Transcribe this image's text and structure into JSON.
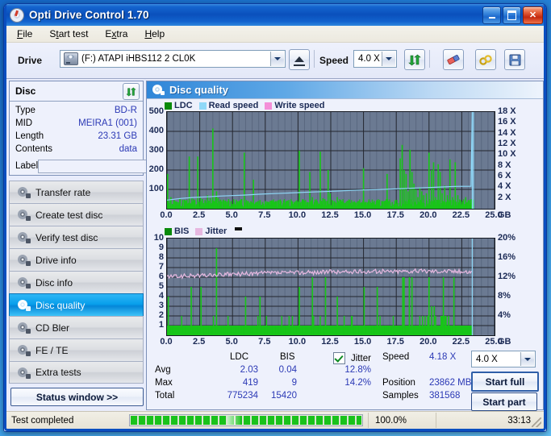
{
  "window": {
    "title": "Opti Drive Control 1.70",
    "icon": "disc-icon",
    "buttons": {
      "minimize": "–",
      "maximize": "□",
      "close": "✕"
    }
  },
  "menu": {
    "items": [
      "File",
      "Start test",
      "Extra",
      "Help"
    ]
  },
  "toolbar": {
    "drive_label": "Drive",
    "drive_value": "(F:)  ATAPI iHBS112  2 CL0K",
    "eject_icon": "eject-icon",
    "speed_label": "Speed",
    "speed_value": "4.0 X",
    "refresh_icon": "refresh-icon",
    "eraser_icon": "eraser-icon",
    "tools_icon": "tools-icon",
    "save_icon": "save-icon"
  },
  "sidebar": {
    "disc_title": "Disc",
    "disc_refresh_icon": "refresh-icon",
    "fields": [
      {
        "key": "Type",
        "value": "BD-R"
      },
      {
        "key": "MID",
        "value": "MEIRA1 (001)"
      },
      {
        "key": "Length",
        "value": "23.31 GB"
      },
      {
        "key": "Contents",
        "value": "data"
      }
    ],
    "label_key": "Label",
    "label_value": "",
    "label_placeholder": "",
    "disc_button_icon": "cd-disc-icon",
    "nav": [
      {
        "label": "Transfer rate",
        "active": false
      },
      {
        "label": "Create test disc",
        "active": false
      },
      {
        "label": "Verify test disc",
        "active": false
      },
      {
        "label": "Drive info",
        "active": false
      },
      {
        "label": "Disc info",
        "active": false
      },
      {
        "label": "Disc quality",
        "active": true
      },
      {
        "label": "CD Bler",
        "active": false
      },
      {
        "label": "FE / TE",
        "active": false
      },
      {
        "label": "Extra tests",
        "active": false
      }
    ],
    "status_window_button": "Status window >>"
  },
  "main": {
    "header_title": "Disc quality",
    "header_icon": "disc-quality-icon",
    "stats": {
      "col_headers": [
        "LDC",
        "BIS"
      ],
      "rows": [
        {
          "label": "Avg",
          "ldc": "2.03",
          "bis": "0.04",
          "jitter": "12.8%"
        },
        {
          "label": "Max",
          "ldc": "419",
          "bis": "9",
          "jitter": "14.2%"
        },
        {
          "label": "Total",
          "ldc": "775234",
          "bis": "15420",
          "jitter": ""
        }
      ],
      "jitter_label": "Jitter",
      "jitter_checked": true,
      "right": [
        {
          "key": "Speed",
          "value": "4.18 X"
        },
        {
          "key": "Position",
          "value": "23862 MB"
        },
        {
          "key": "Samples",
          "value": "381568"
        }
      ],
      "speed_select": "4.0 X",
      "start_full_button": "Start full",
      "start_part_button": "Start part"
    }
  },
  "statusbar": {
    "message": "Test completed",
    "progress_text": "100.0%",
    "progress_value": 100,
    "elapsed": "33:13"
  },
  "colors": {
    "ldc_green": "#18c518",
    "read_speed_blue": "#8fd8f8",
    "write_speed_pink": "#f48fd8",
    "bis_green": "#18c518",
    "jitter_pink": "#e6b8e0",
    "plot_bg": "#6b7a92",
    "accent_blue": "#2b39b5",
    "active_nav": "#08a0ec"
  },
  "chart_data": [
    {
      "type": "line",
      "title": "LDC / Read speed / Write speed",
      "xlabel": "GB",
      "ylabel": "LDC",
      "y2label": "Speed (X)",
      "xlim": [
        0.0,
        25.0
      ],
      "ylim": [
        0,
        500
      ],
      "y2lim": [
        0,
        18
      ],
      "xticks": [
        "0.0",
        "2.5",
        "5.0",
        "7.5",
        "10.0",
        "12.5",
        "15.0",
        "17.5",
        "20.0",
        "22.5",
        "25.0"
      ],
      "yticks": [
        100,
        200,
        300,
        400,
        500
      ],
      "y2ticks": [
        "2 X",
        "4 X",
        "6 X",
        "8 X",
        "10 X",
        "12 X",
        "14 X",
        "16 X",
        "18 X"
      ],
      "xunit": "GB",
      "grid": true,
      "legend": [
        {
          "name": "LDC",
          "color": "#0a8a0a"
        },
        {
          "name": "Read speed",
          "color": "#8fd8f8"
        },
        {
          "name": "Write speed",
          "color": "#f48fd8"
        }
      ],
      "series": [
        {
          "name": "LDC",
          "type": "impulse",
          "color": "#18c518",
          "x": [
            0.05,
            0.3,
            0.55,
            0.8,
            1.0,
            1.2,
            1.45,
            1.7,
            1.9,
            2.1,
            2.35,
            2.55,
            2.7,
            2.9,
            3.1,
            3.3,
            3.5,
            3.7,
            3.78,
            3.9,
            4.1,
            4.3,
            4.5,
            4.7,
            4.9,
            5.1,
            5.3,
            5.5,
            5.7,
            5.9,
            6.05,
            6.2,
            6.4,
            6.6,
            6.8,
            6.95,
            7.1,
            7.3,
            7.5,
            7.7,
            7.9,
            8.1,
            8.3,
            8.5,
            8.7,
            8.9,
            9.1,
            9.3,
            9.5,
            9.7,
            9.9,
            10.1,
            10.35,
            10.5,
            10.7,
            10.9,
            11.1,
            11.3,
            11.5,
            11.7,
            11.9,
            12.1,
            12.3,
            12.45,
            12.6,
            12.8,
            13.0,
            13.2,
            13.4,
            13.6,
            13.8,
            14.0,
            14.2,
            14.4,
            14.6,
            14.8,
            15.0,
            15.2,
            15.4,
            15.6,
            15.8,
            16.0,
            16.2,
            16.4,
            16.6,
            16.8,
            17.0,
            17.2,
            17.4,
            17.6,
            17.8,
            17.95,
            18.1,
            18.25,
            18.4,
            18.55,
            18.7,
            18.85,
            19.0,
            19.15,
            19.3,
            19.45,
            19.6,
            19.8,
            20.0,
            20.2,
            20.35,
            20.5,
            20.7,
            20.85,
            21.0,
            21.2,
            21.4,
            21.6,
            21.8,
            22.0,
            22.2,
            22.4,
            22.6,
            22.8,
            23.0,
            23.2,
            23.4
          ],
          "y": [
            180,
            60,
            40,
            35,
            50,
            45,
            40,
            270,
            55,
            45,
            270,
            60,
            50,
            45,
            70,
            55,
            415,
            60,
            90,
            55,
            45,
            40,
            35,
            50,
            40,
            45,
            35,
            40,
            50,
            290,
            45,
            40,
            40,
            150,
            35,
            40,
            45,
            35,
            40,
            35,
            40,
            35,
            40,
            35,
            40,
            35,
            40,
            35,
            40,
            35,
            40,
            300,
            45,
            40,
            35,
            190,
            60,
            40,
            35,
            295,
            55,
            40,
            200,
            80,
            45,
            40,
            60,
            35,
            40,
            30,
            40,
            30,
            35,
            30,
            40,
            30,
            210,
            35,
            40,
            30,
            35,
            40,
            30,
            40,
            30,
            180,
            40,
            35,
            40,
            30,
            260,
            330,
            200,
            180,
            90,
            305,
            190,
            130,
            100,
            60,
            110,
            90,
            70,
            80,
            290,
            200,
            240,
            60,
            230,
            190,
            80,
            120,
            70,
            255,
            60,
            240,
            70,
            45,
            40,
            60,
            40,
            30,
            35
          ]
        },
        {
          "name": "Read speed",
          "type": "line",
          "color": "#8fd8f8",
          "x": [
            0.0,
            1.0,
            2.0,
            3.0,
            4.0,
            5.0,
            6.0,
            7.0,
            8.0,
            9.0,
            10.0,
            11.0,
            12.0,
            13.0,
            14.0,
            15.0,
            16.0,
            17.0,
            18.0,
            19.0,
            20.0,
            21.0,
            22.0,
            23.2,
            23.3,
            23.3
          ],
          "y_speed": [
            1.6,
            1.9,
            2.1,
            2.2,
            2.35,
            2.45,
            2.55,
            2.7,
            2.8,
            2.9,
            3.0,
            3.1,
            3.2,
            3.3,
            3.4,
            3.5,
            3.55,
            3.65,
            3.75,
            3.85,
            3.95,
            4.05,
            4.15,
            4.18,
            18.0,
            0.0
          ]
        },
        {
          "name": "Write speed",
          "type": "line",
          "color": "#f48fd8",
          "x": [],
          "y_speed": []
        }
      ],
      "data_end_x": 23.4
    },
    {
      "type": "line",
      "title": "BIS / Jitter",
      "xlabel": "GB",
      "ylabel": "BIS",
      "y2label": "Jitter (%)",
      "xlim": [
        0.0,
        25.0
      ],
      "ylim": [
        0,
        10
      ],
      "y2lim": [
        0,
        20
      ],
      "xticks": [
        "0.0",
        "2.5",
        "5.0",
        "7.5",
        "10.0",
        "12.5",
        "15.0",
        "17.5",
        "20.0",
        "22.5",
        "25.0"
      ],
      "yticks": [
        1,
        2,
        3,
        4,
        5,
        6,
        7,
        8,
        9,
        10
      ],
      "y2ticks": [
        "4%",
        "8%",
        "12%",
        "16%",
        "20%"
      ],
      "xunit": "GB",
      "grid": true,
      "legend": [
        {
          "name": "BIS",
          "color": "#0a8a0a"
        },
        {
          "name": "Jitter",
          "color": "#e6b8e0"
        }
      ],
      "series": [
        {
          "name": "BIS",
          "type": "impulse",
          "color": "#18c518",
          "x": [
            0.1,
            0.35,
            0.6,
            0.85,
            1.1,
            1.35,
            1.6,
            1.85,
            2.1,
            2.35,
            2.6,
            2.85,
            3.1,
            3.35,
            3.6,
            3.78,
            4.0,
            4.25,
            4.5,
            4.75,
            5.0,
            5.25,
            5.5,
            5.75,
            6.0,
            6.1,
            6.35,
            6.6,
            6.85,
            7.1,
            7.35,
            7.6,
            7.85,
            8.1,
            8.35,
            8.6,
            8.85,
            9.1,
            9.35,
            9.6,
            9.85,
            10.1,
            10.45,
            10.7,
            10.95,
            11.1,
            11.35,
            11.6,
            11.85,
            12.1,
            12.35,
            12.5,
            12.75,
            13.0,
            13.25,
            13.3,
            13.55,
            13.8,
            14.05,
            14.3,
            14.55,
            14.8,
            15.05,
            15.3,
            15.55,
            15.8,
            16.05,
            16.3,
            16.5,
            16.8,
            17.05,
            17.3,
            17.55,
            17.8,
            18.0,
            18.1,
            18.3,
            18.5,
            18.7,
            18.9,
            19.0,
            19.2,
            19.4,
            19.6,
            19.8,
            20.0,
            20.2,
            20.4,
            20.5,
            20.7,
            20.9,
            21.1,
            21.3,
            21.5,
            21.7,
            21.9,
            22.1,
            22.3,
            22.5,
            22.7,
            22.9,
            23.1,
            23.3
          ],
          "y": [
            4,
            1,
            1,
            1,
            1,
            1,
            1,
            5,
            1,
            1,
            5,
            1,
            1,
            1,
            1,
            9,
            1,
            1,
            1,
            1,
            1,
            1,
            1,
            1,
            4,
            1,
            1,
            1,
            1,
            4,
            1,
            1,
            1,
            1,
            1,
            1,
            1,
            1,
            1,
            1,
            1,
            5,
            1,
            1,
            1,
            6,
            1,
            1,
            1,
            6,
            1,
            1,
            1,
            4,
            1,
            1,
            1,
            1,
            1,
            1,
            1,
            1,
            5,
            1,
            1,
            1,
            5,
            1,
            1,
            1,
            1,
            1,
            1,
            1,
            6,
            6,
            1,
            6,
            6,
            1,
            1,
            1,
            1,
            1,
            1,
            6,
            3,
            3,
            2,
            1,
            1,
            6,
            2,
            2,
            1,
            6,
            1,
            1,
            1,
            1,
            1,
            1,
            1
          ]
        },
        {
          "name": "Jitter",
          "type": "line",
          "color": "#e6b8e0",
          "x": [
            0.0,
            1.0,
            2.0,
            3.0,
            4.0,
            5.0,
            6.0,
            7.0,
            8.0,
            9.0,
            10.0,
            11.0,
            12.0,
            13.0,
            14.0,
            15.0,
            16.0,
            17.0,
            18.0,
            19.0,
            20.0,
            21.0,
            22.0,
            23.3
          ],
          "y_pct": [
            12.1,
            12.2,
            12.3,
            12.4,
            12.5,
            12.6,
            12.7,
            12.8,
            12.9,
            12.9,
            13.0,
            13.0,
            13.1,
            13.1,
            13.1,
            13.2,
            13.2,
            13.2,
            13.3,
            13.3,
            13.3,
            13.3,
            13.2,
            13.1
          ]
        }
      ],
      "data_end_x": 23.3
    }
  ]
}
